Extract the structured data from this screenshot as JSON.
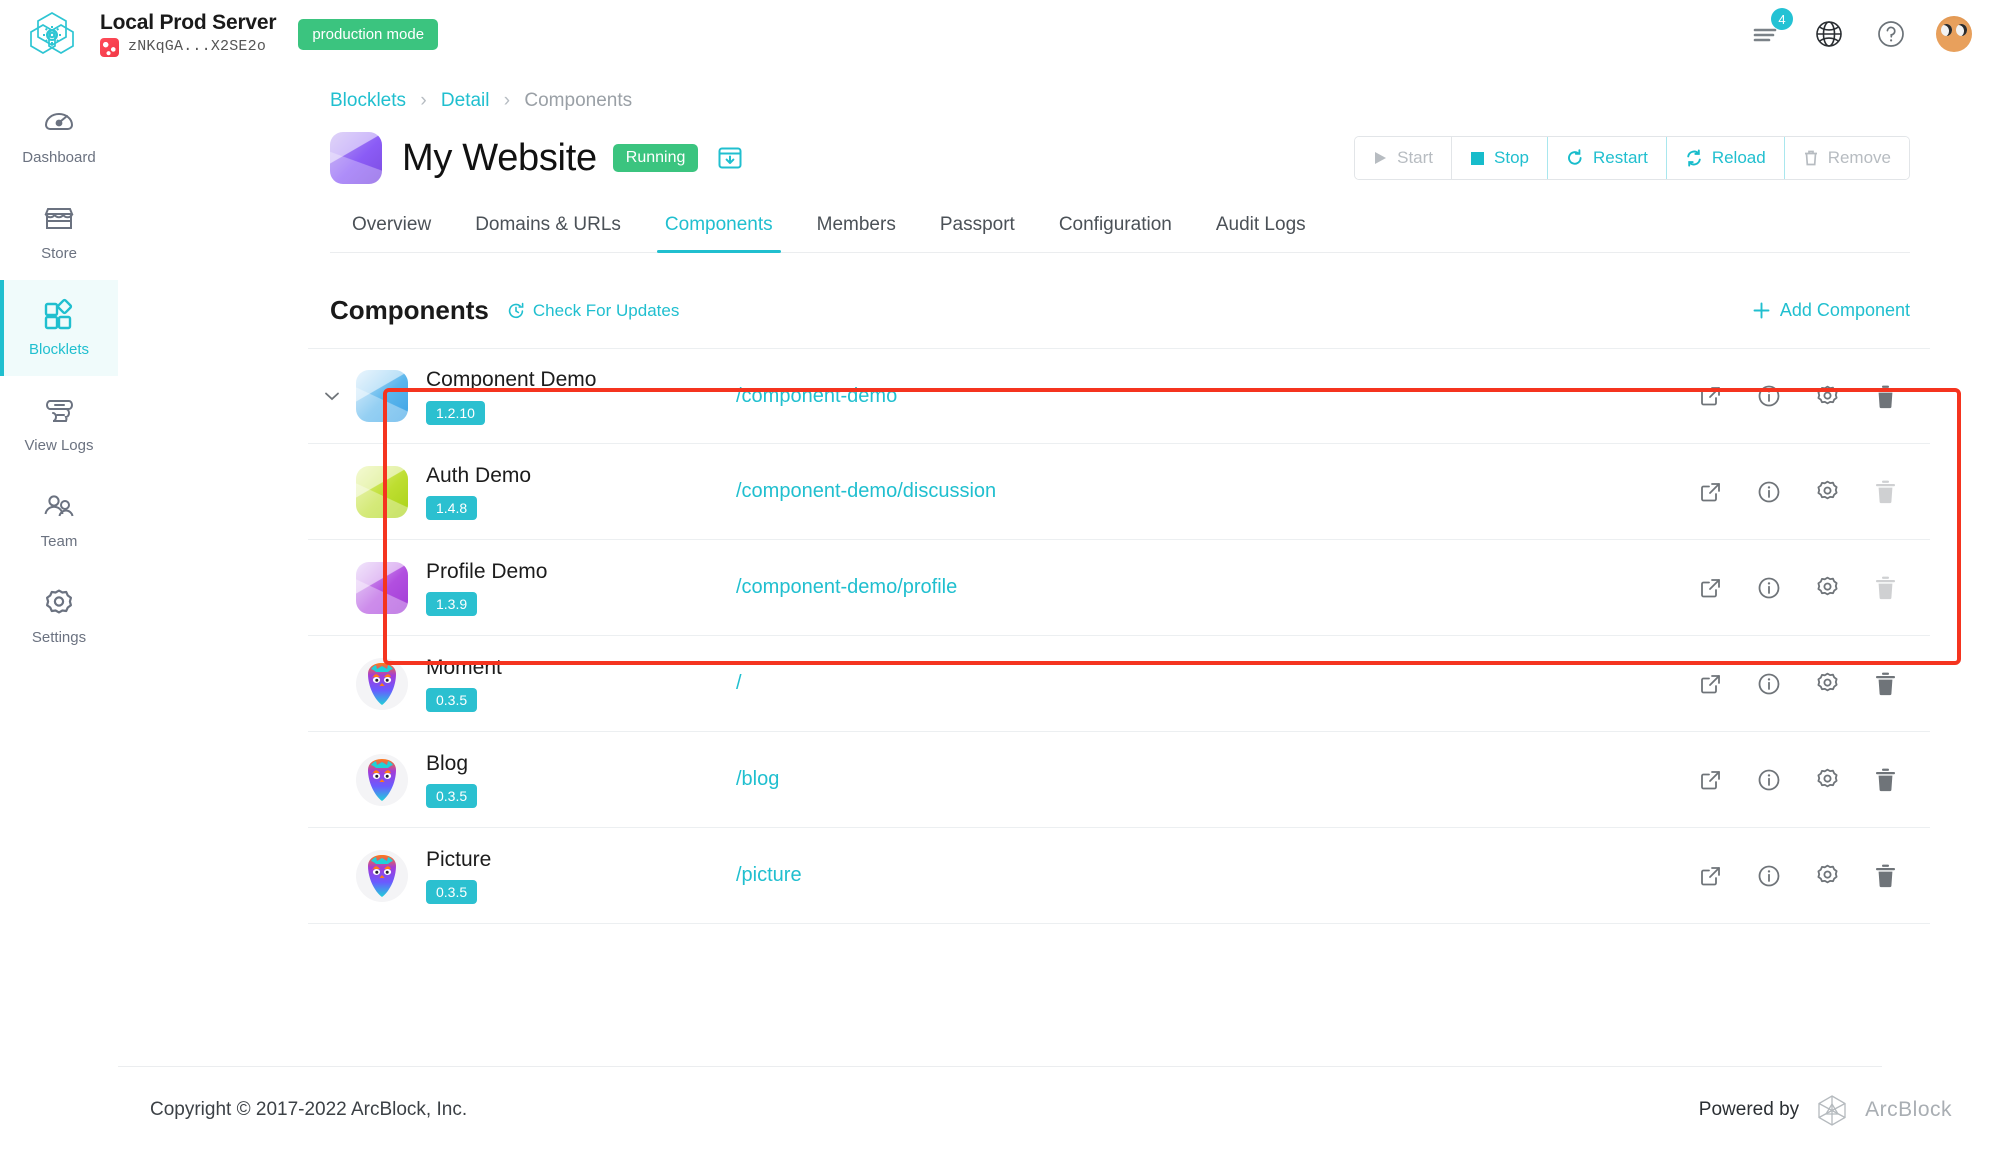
{
  "topbar": {
    "logo_icon": "arcblock-hexagon-logo",
    "server_name": "Local Prod Server",
    "did": "zNKqGA...X2SE2o",
    "did_icon": "did-avatar-icon",
    "mode_badge": "production mode",
    "notifications_icon": "notifications-list-icon",
    "notifications_count": "4",
    "locale_icon": "globe-icon",
    "help_icon": "help-circle-icon",
    "avatar_icon": "user-avatar"
  },
  "sidebar": {
    "items": [
      {
        "label": "Dashboard",
        "icon": "dashboard-gauge-icon",
        "active": false
      },
      {
        "label": "Store",
        "icon": "store-icon",
        "active": false
      },
      {
        "label": "Blocklets",
        "icon": "blocklets-grid-icon",
        "active": true
      },
      {
        "label": "View Logs",
        "icon": "logs-scroll-icon",
        "active": false
      },
      {
        "label": "Team",
        "icon": "team-people-icon",
        "active": false
      },
      {
        "label": "Settings",
        "icon": "settings-gear-icon",
        "active": false
      }
    ]
  },
  "breadcrumb": {
    "items": [
      "Blocklets",
      "Detail",
      "Components"
    ],
    "separator": "›"
  },
  "header": {
    "app_icon": "my-website-app-icon",
    "title": "My Website",
    "status": "Running",
    "status_color": "#3bc47f",
    "download_icon": "download-box-icon",
    "actions": [
      {
        "label": "Start",
        "icon": "play-icon",
        "state": "disabled"
      },
      {
        "label": "Stop",
        "icon": "stop-square-icon",
        "state": "enabled"
      },
      {
        "label": "Restart",
        "icon": "restart-arrow-icon",
        "state": "enabled"
      },
      {
        "label": "Reload",
        "icon": "reload-arrows-icon",
        "state": "enabled"
      },
      {
        "label": "Remove",
        "icon": "trash-icon",
        "state": "disabled"
      }
    ]
  },
  "tabs": [
    {
      "label": "Overview",
      "active": false
    },
    {
      "label": "Domains & URLs",
      "active": false
    },
    {
      "label": "Components",
      "active": true
    },
    {
      "label": "Members",
      "active": false
    },
    {
      "label": "Passport",
      "active": false
    },
    {
      "label": "Configuration",
      "active": false
    },
    {
      "label": "Audit Logs",
      "active": false
    }
  ],
  "components_section": {
    "title": "Components",
    "check_updates_label": "Check For Updates",
    "check_updates_icon": "refresh-clock-icon",
    "add_component_label": "Add Component",
    "add_component_icon": "plus-icon",
    "accent_color": "#20bfcf",
    "highlight_color": "#f5341f",
    "row_action_icons": [
      "external-link-icon",
      "info-circle-icon",
      "gear-icon",
      "trash-icon"
    ],
    "rows": [
      {
        "name": "Component Demo",
        "version": "1.2.10",
        "path": "/component-demo",
        "icon": "icon-component-demo",
        "is_parent": true,
        "expanded": true,
        "chevron_icon": "chevron-down-icon",
        "delete_enabled": true,
        "highlighted": false
      },
      {
        "name": "Auth Demo",
        "version": "1.4.8",
        "path": "/component-demo/discussion",
        "icon": "icon-auth-demo",
        "is_parent": false,
        "delete_enabled": false,
        "highlighted": false
      },
      {
        "name": "Profile Demo",
        "version": "1.3.9",
        "path": "/component-demo/profile",
        "icon": "icon-profile-demo",
        "is_parent": false,
        "delete_enabled": false,
        "highlighted": false
      },
      {
        "name": "Moment",
        "version": "0.3.5",
        "path": "/",
        "icon": "icon-mascot",
        "is_parent": false,
        "delete_enabled": true,
        "highlighted": true
      },
      {
        "name": "Blog",
        "version": "0.3.5",
        "path": "/blog",
        "icon": "icon-mascot",
        "is_parent": false,
        "delete_enabled": true,
        "highlighted": true
      },
      {
        "name": "Picture",
        "version": "0.3.5",
        "path": "/picture",
        "icon": "icon-mascot",
        "is_parent": false,
        "delete_enabled": true,
        "highlighted": true
      }
    ]
  },
  "footer": {
    "copyright": "Copyright © 2017-2022  ArcBlock, Inc.",
    "powered_by_label": "Powered by",
    "powered_by_name": "ArcBlock",
    "powered_by_icon": "arcblock-cube-logo"
  }
}
